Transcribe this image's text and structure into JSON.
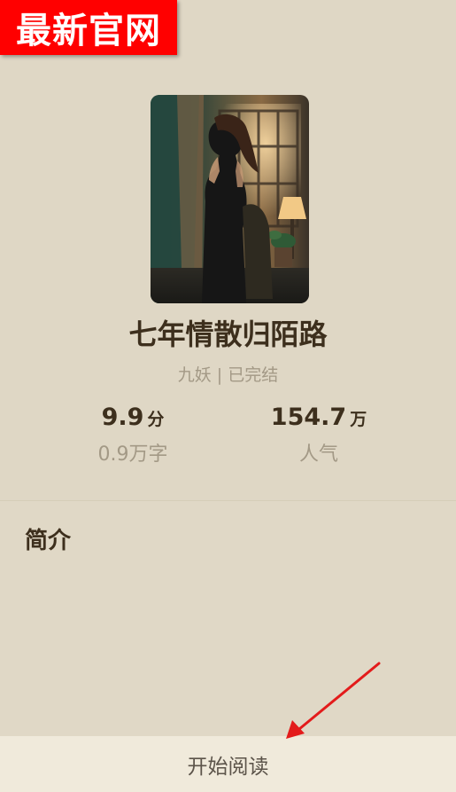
{
  "badge": {
    "text": "最新官网",
    "color": "#ff0000"
  },
  "book": {
    "title": "七年情散归陌路",
    "meta": "九妖 | 已完结",
    "stats": [
      {
        "value": "9.9",
        "unit": "分",
        "label": "0.9万字"
      },
      {
        "value": "154.7",
        "unit": "万",
        "label": "人气"
      }
    ]
  },
  "intro": {
    "heading": "简介"
  },
  "bottom_bar": {
    "read_label": "开始阅读"
  },
  "colors": {
    "background": "#dfd7c5",
    "title_text": "#3d2f1d",
    "muted_text": "#a39986",
    "bottom_bar": "#f0eadb",
    "arrow": "#e31b1b"
  }
}
